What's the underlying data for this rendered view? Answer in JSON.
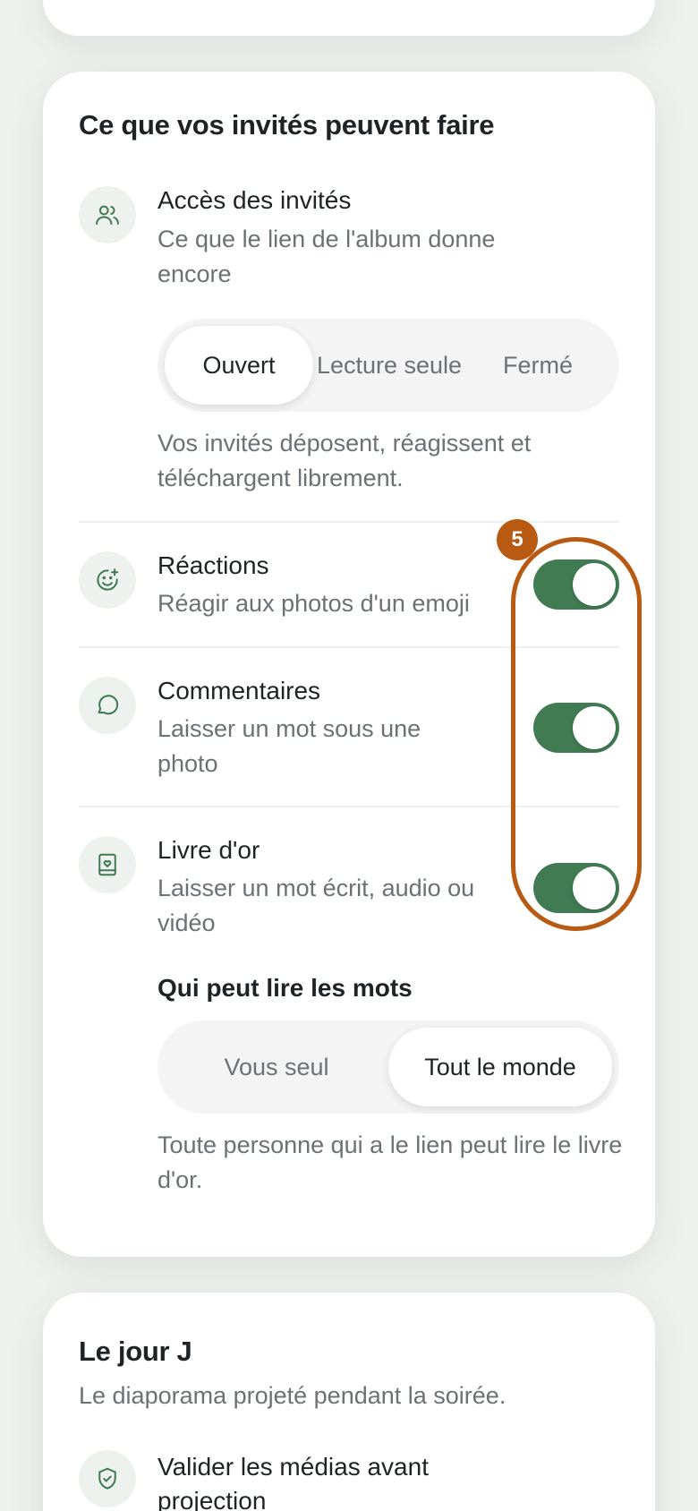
{
  "permissions": {
    "title": "Ce que vos invités peuvent faire",
    "guest_access": {
      "title": "Accès des invités",
      "description": "Ce que le lien de l'album donne encore",
      "options": [
        "Ouvert",
        "Lecture seule",
        "Fermé"
      ],
      "selected": "Ouvert",
      "note": "Vos invités déposent, réagissent et téléchargent librement."
    },
    "reactions": {
      "title": "Réactions",
      "description": "Réagir aux photos d'un emoji",
      "enabled": true
    },
    "comments": {
      "title": "Commentaires",
      "description": "Laisser un mot sous une photo",
      "enabled": true
    },
    "guestbook": {
      "title": "Livre d'or",
      "description": "Laisser un mot écrit, audio ou vidéo",
      "enabled": true,
      "readers_label": "Qui peut lire les mots",
      "readers_options": [
        "Vous seul",
        "Tout le monde"
      ],
      "readers_selected": "Tout le monde",
      "readers_note": "Toute personne qui a le lien peut lire le livre d'or."
    }
  },
  "annotation": {
    "step_number": "5",
    "color": "#b95a12"
  },
  "big_day": {
    "title": "Le jour J",
    "subtitle": "Le diaporama projeté pendant la soirée.",
    "validate": {
      "title": "Valider les médias avant projection"
    }
  },
  "colors": {
    "accent": "#417b52",
    "icon": "#3e7a50",
    "background": "#eef1ee",
    "annotation": "#b95a12"
  }
}
